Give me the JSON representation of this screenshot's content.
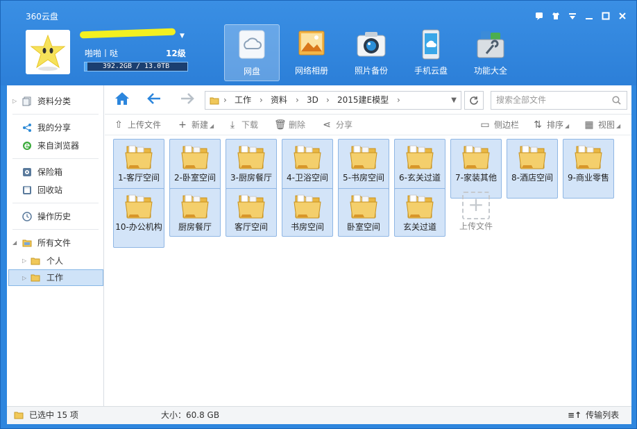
{
  "app": {
    "title": "360云盘"
  },
  "user": {
    "nickname": "啪啪丨哒",
    "level": "12级",
    "quota_text": "392.2GB / 13.0TB",
    "quota_fraction": 0.029
  },
  "nav": {
    "items": [
      {
        "label": "网盘",
        "icon": "cloud-disk-icon",
        "active": true
      },
      {
        "label": "网络相册",
        "icon": "photo-album-icon",
        "active": false
      },
      {
        "label": "照片备份",
        "icon": "camera-icon",
        "active": false
      },
      {
        "label": "手机云盘",
        "icon": "phone-icon",
        "active": false
      },
      {
        "label": "功能大全",
        "icon": "toolbox-icon",
        "active": false
      }
    ]
  },
  "sidebar": {
    "items": [
      {
        "label": "资料分类",
        "icon": "documents-icon"
      },
      {
        "label": "我的分享",
        "icon": "share-icon"
      },
      {
        "label": "来自浏览器",
        "icon": "browser-icon"
      },
      {
        "label": "保险箱",
        "icon": "safe-icon"
      },
      {
        "label": "回收站",
        "icon": "recycle-bin-icon"
      },
      {
        "label": "操作历史",
        "icon": "history-icon"
      },
      {
        "label": "所有文件",
        "icon": "folder-icon"
      },
      {
        "label": "个人",
        "icon": "folder-icon"
      },
      {
        "label": "工作",
        "icon": "folder-icon"
      }
    ]
  },
  "address": {
    "crumbs": [
      "工作",
      "资料",
      "3D",
      "2015建E模型"
    ],
    "search_placeholder": "搜索全部文件"
  },
  "toolbar": {
    "upload": "上传文件",
    "new": "新建",
    "download": "下载",
    "delete": "删除",
    "share": "分享",
    "sidebar": "侧边栏",
    "sort": "排序",
    "view": "视图"
  },
  "files": [
    "1-客厅空间",
    "2-卧室空间",
    "3-厨房餐厅",
    "4-卫浴空间",
    "5-书房空间",
    "6-玄关过道",
    "7-家装其他",
    "8-酒店空间",
    "9-商业零售",
    "10-办公机构",
    "厨房餐厅",
    "客厅空间",
    "书房空间",
    "卧室空间",
    "玄关过道"
  ],
  "upload_tile": {
    "label": "上传文件"
  },
  "status": {
    "selected": "已选中 15 项",
    "size": "大小：60.8 GB",
    "transfer": "传输列表"
  },
  "colors": {
    "header": "#2e86de",
    "tile_bg": "#d3e4f8",
    "tile_border": "#8fb6e4"
  }
}
